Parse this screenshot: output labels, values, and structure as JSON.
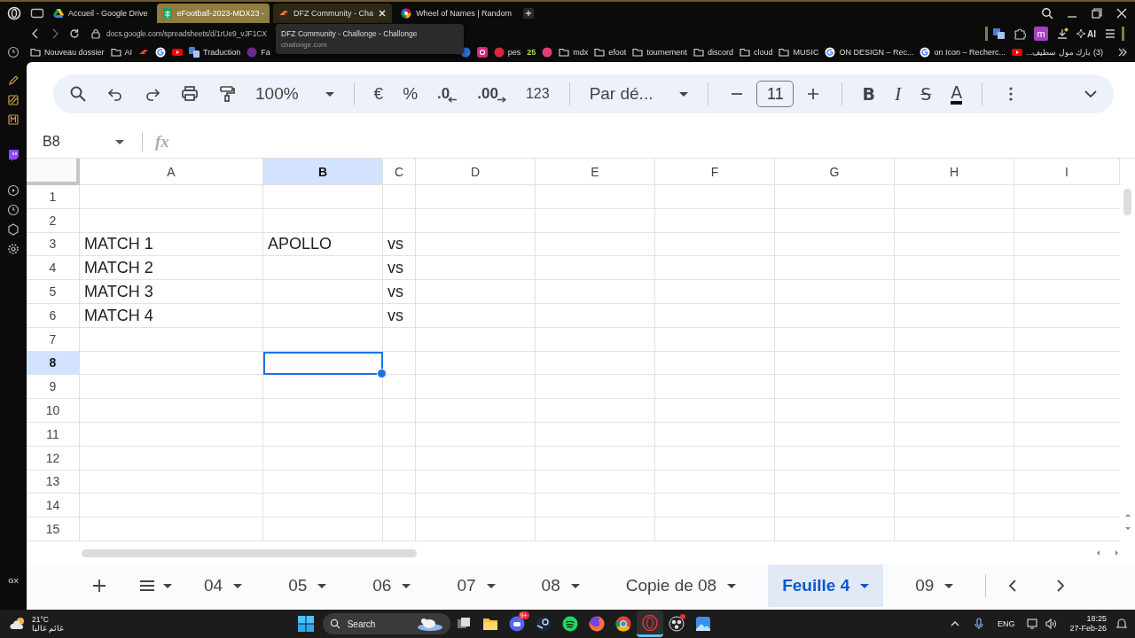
{
  "browser": {
    "tabs": [
      {
        "title": "Accueil - Google Drive",
        "kind": "drive",
        "selected": false,
        "hovered": false
      },
      {
        "title": "eFootball-2023-MDX23 -",
        "kind": "sheets",
        "selected": true,
        "hovered": false
      },
      {
        "title": "DFZ Community - Cha",
        "kind": "challonge",
        "selected": false,
        "hovered": true
      },
      {
        "title": "Wheel of Names | Random",
        "kind": "wheel",
        "selected": false,
        "hovered": false
      }
    ],
    "address": "docs.google.com/spreadsheets/d/1rUe9_vJF1CX",
    "tooltip": {
      "title": "DFZ Community - Challonge - Challonge",
      "url": "challonge.com"
    },
    "extensions": [
      {
        "kind": "translate"
      },
      {
        "kind": "puzzle"
      },
      {
        "kind": "letter",
        "label": "m"
      },
      {
        "kind": "download"
      },
      {
        "kind": "ai",
        "label": "AI"
      },
      {
        "kind": "menu"
      }
    ],
    "bookmarks_before": [
      {
        "kind": "folder",
        "label": "Nouveau dossier"
      },
      {
        "kind": "folder",
        "label": "AI"
      },
      {
        "kind": "challonge"
      },
      {
        "kind": "google"
      },
      {
        "kind": "youtube"
      },
      {
        "kind": "translate",
        "label": "Traduction"
      },
      {
        "kind": "purple",
        "label": "Fa"
      }
    ],
    "bookmarks_after": [
      {
        "kind": "blue"
      },
      {
        "kind": "instagram"
      },
      {
        "kind": "red",
        "label": "pes"
      },
      {
        "kind": "plain",
        "label": "25"
      },
      {
        "kind": "pink"
      },
      {
        "kind": "folder",
        "label": "mdx"
      },
      {
        "kind": "folder",
        "label": "efoot"
      },
      {
        "kind": "folder",
        "label": "tournement"
      },
      {
        "kind": "folder",
        "label": "discord"
      },
      {
        "kind": "folder",
        "label": "cloud"
      },
      {
        "kind": "folder",
        "label": "MUSIC"
      },
      {
        "kind": "google",
        "label": "ON DESIGN – Rec..."
      },
      {
        "kind": "google",
        "label": "on Icon – Recherc..."
      },
      {
        "kind": "youtube",
        "label": "(3) بارك مول سطيف..."
      }
    ],
    "sidebar_label": "GX"
  },
  "toolbar": {
    "zoom": "100%",
    "currency": "€",
    "percent": "%",
    "decrease_decimals": ".0",
    "increase_decimals": ".00",
    "number_format": "123",
    "font": "Par dé...",
    "font_size": "11",
    "bold": "B",
    "italic": "I",
    "strikethrough": "S",
    "text_color": "A"
  },
  "formula_bar": {
    "cell_reference": "B8",
    "function_label": "fx"
  },
  "sheet": {
    "columns": [
      {
        "label": "A",
        "selected": false
      },
      {
        "label": "B",
        "selected": true
      },
      {
        "label": "C",
        "selected": false
      },
      {
        "label": "D",
        "selected": false
      },
      {
        "label": "E",
        "selected": false
      },
      {
        "label": "F",
        "selected": false
      },
      {
        "label": "G",
        "selected": false
      },
      {
        "label": "H",
        "selected": false
      },
      {
        "label": "I",
        "selected": false
      }
    ],
    "rows": [
      {
        "number": "1",
        "selected": false
      },
      {
        "number": "2",
        "selected": false
      },
      {
        "number": "3",
        "selected": false,
        "cells": [
          "MATCH 1",
          "APOLLO",
          "vs"
        ]
      },
      {
        "number": "4",
        "selected": false,
        "cells": [
          "MATCH 2",
          null,
          "vs"
        ]
      },
      {
        "number": "5",
        "selected": false,
        "cells": [
          "MATCH 3",
          null,
          "vs"
        ]
      },
      {
        "number": "6",
        "selected": false,
        "cells": [
          "MATCH 4",
          null,
          "vs"
        ]
      },
      {
        "number": "7",
        "selected": false
      },
      {
        "number": "8",
        "selected": true
      },
      {
        "number": "9",
        "selected": false
      },
      {
        "number": "10",
        "selected": false
      },
      {
        "number": "11",
        "selected": false
      },
      {
        "number": "12",
        "selected": false
      },
      {
        "number": "13",
        "selected": false
      },
      {
        "number": "14",
        "selected": false
      },
      {
        "number": "15",
        "selected": false
      }
    ]
  },
  "sheet_tabs": [
    {
      "label": "04",
      "selected": false
    },
    {
      "label": "05",
      "selected": false
    },
    {
      "label": "06",
      "selected": false
    },
    {
      "label": "07",
      "selected": false
    },
    {
      "label": "08",
      "selected": false
    },
    {
      "label": "Copie de 08",
      "selected": false
    },
    {
      "label": "Feuille 4",
      "selected": true
    },
    {
      "label": "09",
      "selected": false
    }
  ],
  "taskbar": {
    "weather": {
      "temperature": "21°C",
      "condition": "غائم غالبا"
    },
    "search": "Search",
    "apps": [
      {
        "kind": "taskview",
        "active": false
      },
      {
        "kind": "explorer",
        "active": false
      },
      {
        "kind": "discord",
        "active": false,
        "badge": "9+"
      },
      {
        "kind": "steam",
        "active": false
      },
      {
        "kind": "spotify",
        "active": false
      },
      {
        "kind": "firefox",
        "active": false
      },
      {
        "kind": "chrome",
        "active": false
      },
      {
        "kind": "opera",
        "active": true
      },
      {
        "kind": "obs",
        "active": false
      },
      {
        "kind": "photos",
        "active": false
      }
    ],
    "language": "ENG",
    "time": "18:25",
    "date": "27-Feb-26"
  }
}
